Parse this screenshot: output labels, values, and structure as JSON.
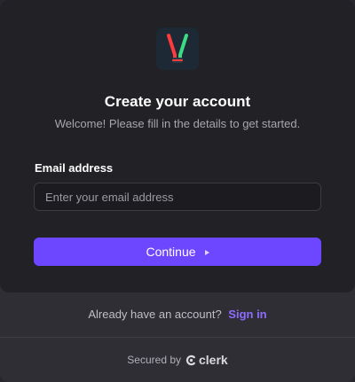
{
  "header": {
    "logo_icon": "app-logo-icon",
    "title": "Create your account",
    "subtitle": "Welcome! Please fill in the details to get started."
  },
  "form": {
    "email_label": "Email address",
    "email_placeholder": "Enter your email address",
    "email_value": "",
    "continue_label": "Continue",
    "continue_icon": "play-icon"
  },
  "footer": {
    "signin_prompt": "Already have an account?",
    "signin_link": "Sign in",
    "secured_by": "Secured by",
    "brand": "clerk"
  },
  "colors": {
    "accent": "#6c47ff",
    "link": "#8e6cff",
    "card_background": "#212126",
    "footer_background": "#2f2e34",
    "logo_red": "#ff3b3b",
    "logo_green": "#3ddc84"
  }
}
